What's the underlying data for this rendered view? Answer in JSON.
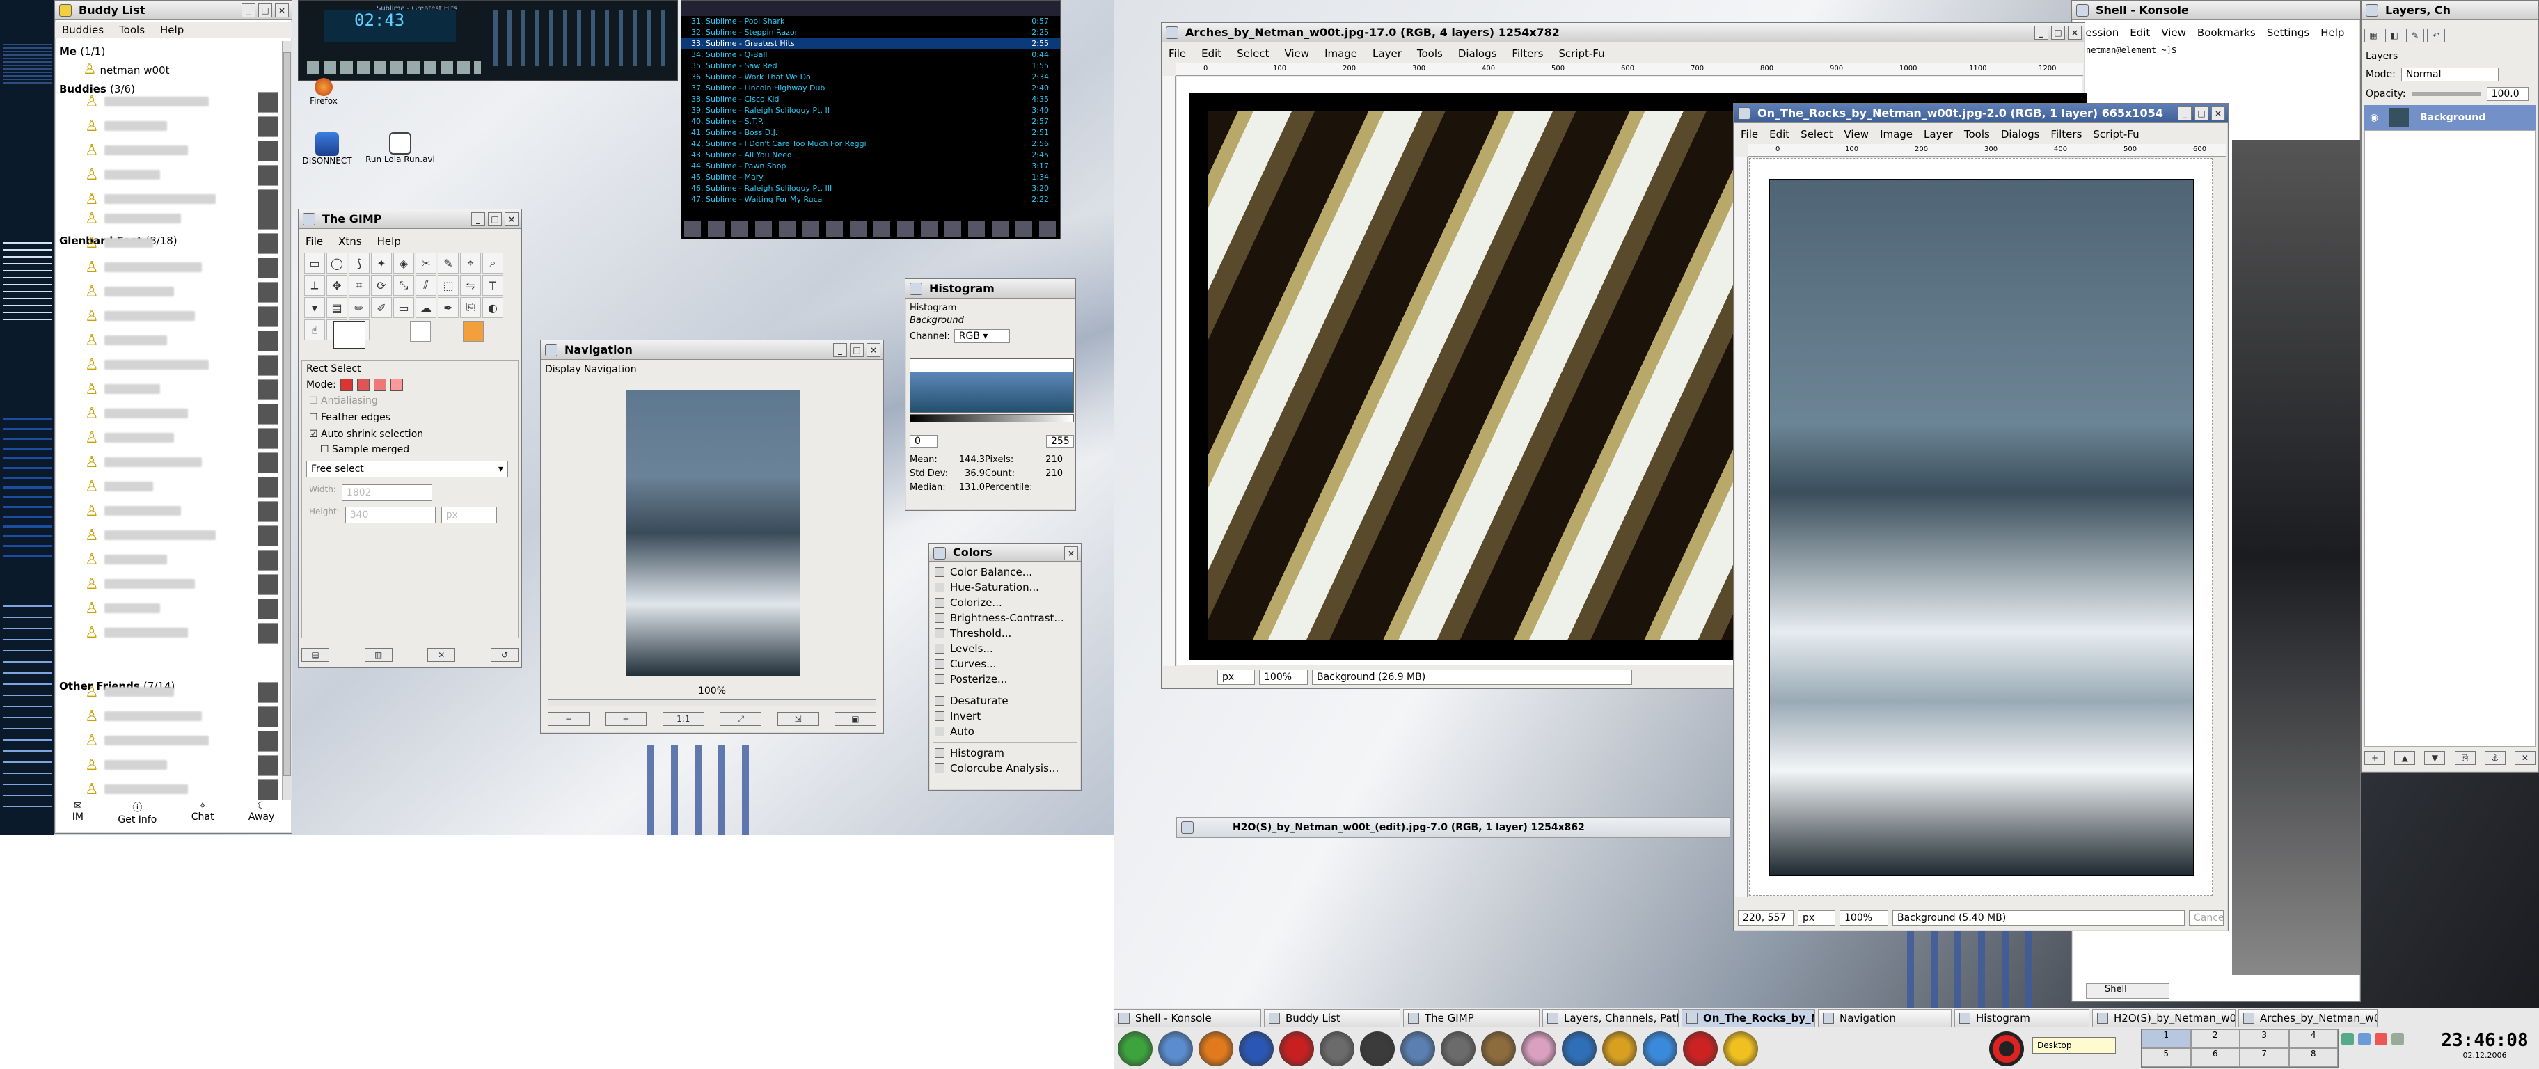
{
  "buddy_list": {
    "title": "Buddy List",
    "menu": [
      "Buddies",
      "Tools",
      "Help"
    ],
    "groups": [
      {
        "label": "Me",
        "count": "(1/1)"
      },
      {
        "label": "Buddies",
        "count": "(3/6)"
      },
      {
        "label": "Glenbard East",
        "count": "(8/18)"
      },
      {
        "label": "Other Friends",
        "count": "(7/14)"
      }
    ],
    "me_name": "netman w00t",
    "bottom": [
      "IM",
      "Get Info",
      "Chat",
      "Away"
    ]
  },
  "firefox_label": "Firefox",
  "desktop_icons": [
    "DISONNECT",
    "Run Lola Run.avi"
  ],
  "music_player": {
    "time": "02:43",
    "title": "Sublime - Greatest Hits"
  },
  "playlist": {
    "items": [
      "31. Sublime - Pool Shark",
      "0:57",
      "32. Sublime - Steppin Razor",
      "2:25",
      "33. Sublime - Greatest Hits",
      "2:55",
      "34. Sublime - Q-Ball",
      "0:44",
      "35. Sublime - Saw Red",
      "1:55",
      "36. Sublime - Work That We Do",
      "2:34",
      "37. Sublime - Lincoln Highway Dub",
      "2:40",
      "38. Sublime - Cisco Kid",
      "4:35",
      "39. Sublime - Raleigh Soliloquy Pt. II",
      "3:40",
      "40. Sublime - S.T.P.",
      "2:57",
      "41. Sublime - Boss D.J.",
      "2:51",
      "42. Sublime - I Don't Care Too Much For Reggi",
      "2:56",
      "43. Sublime - All You Need",
      "2:45",
      "44. Sublime - Pawn Shop",
      "3:17",
      "45. Sublime - Mary",
      "1:34",
      "46. Sublime - Raleigh Soliloquy Pt. III",
      "3:20",
      "47. Sublime - Waiting For My Ruca",
      "2:22"
    ]
  },
  "gimp_toolbox": {
    "title": "The GIMP",
    "menu": [
      "File",
      "Xtns",
      "Help"
    ],
    "options_title": "Rect Select",
    "mode_label": "Mode:",
    "antialias": "Antialiasing",
    "feather": "Feather edges",
    "auto_shrink": "Auto shrink selection",
    "sample_merged": "Sample merged",
    "select_mode": "Free select",
    "width_label": "Width:",
    "width_value": "1802",
    "height_label": "Height:",
    "height_value": "340",
    "unit": "px"
  },
  "navigation": {
    "title": "Navigation",
    "panel": "Display Navigation",
    "zoom": "100%"
  },
  "histogram": {
    "title": "Histogram",
    "panel": "Histogram",
    "layer": "Background",
    "channel_label": "Channel:",
    "channel_value": "RGB",
    "range_min": "0",
    "range_max": "255",
    "stats": [
      [
        "Mean:",
        "144.3",
        "Pixels:",
        "210"
      ],
      [
        "Std Dev:",
        "36.9",
        "Count:",
        "210"
      ],
      [
        "Median:",
        "131.0",
        "Percentile:",
        ""
      ]
    ]
  },
  "colors_menu": {
    "title": "Colors",
    "items": [
      "Color Balance...",
      "Hue-Saturation...",
      "Colorize...",
      "Brightness-Contrast...",
      "Threshold...",
      "Levels...",
      "Curves...",
      "Posterize..."
    ],
    "items2": [
      "Desaturate",
      "Invert",
      "Auto"
    ],
    "items3": [
      "Histogram",
      "Colorcube Analysis..."
    ]
  },
  "image_menu": [
    "File",
    "Edit",
    "Select",
    "View",
    "Image",
    "Layer",
    "Tools",
    "Dialogs",
    "Filters",
    "Script-Fu"
  ],
  "arches": {
    "title": "Arches_by_Netman_w00t.jpg-17.0 (RGB, 4 layers) 1254x782",
    "unit": "px",
    "zoom": "100%",
    "status": "Background (26.9 MB)",
    "ruler": [
      "0",
      "100",
      "200",
      "300",
      "400",
      "500",
      "600",
      "700",
      "800",
      "900",
      "1000",
      "1100",
      "1200"
    ]
  },
  "rocks": {
    "title": "On_The_Rocks_by_Netman_w00t.jpg-2.0 (RGB, 1 layer) 665x1054",
    "coords": "220, 557",
    "unit": "px",
    "zoom": "100%",
    "status": "Background (5.40 MB)",
    "cancel": "Cancel",
    "ruler": [
      "0",
      "100",
      "200",
      "300",
      "400",
      "500",
      "600"
    ]
  },
  "h2o": {
    "title": "H2O(S)_by_Netman_w00t_(edit).jpg-7.0 (RGB, 1 layer) 1254x862"
  },
  "konsole": {
    "title": "Shell - Konsole",
    "menu": [
      "Session",
      "Edit",
      "View",
      "Bookmarks",
      "Settings",
      "Help"
    ],
    "prompt": "netman@element ~]$ ",
    "tab": "Shell"
  },
  "layers": {
    "title": "Layers, Ch",
    "panel": "Layers",
    "mode_label": "Mode:",
    "mode_value": "Normal",
    "opacity_label": "Opacity:",
    "opacity_value": "100.0",
    "layer_name": "Background"
  },
  "taskbar": {
    "tasks": [
      "Shell - Konsole",
      "Buddy List",
      "The GIMP",
      "Layers, Channels, Paths",
      "On_The_Rocks_by_N",
      "Navigation",
      "Histogram",
      "H2O(S)_by_Netman_w0",
      "Arches_by_Netman_w0"
    ],
    "pager": [
      "1",
      "2",
      "3",
      "4",
      "5",
      "6",
      "7",
      "8"
    ],
    "tooltip": "Desktop",
    "clock_time": "23:46:08",
    "clock_date": "02.12.2006"
  },
  "colors": {
    "gimp_blue": "#7390c8",
    "selected": "#274a8c",
    "title_grad": "#cfcfcf",
    "taskbar": "#e8e8e8",
    "panel_dark": "#0b1a2b"
  }
}
